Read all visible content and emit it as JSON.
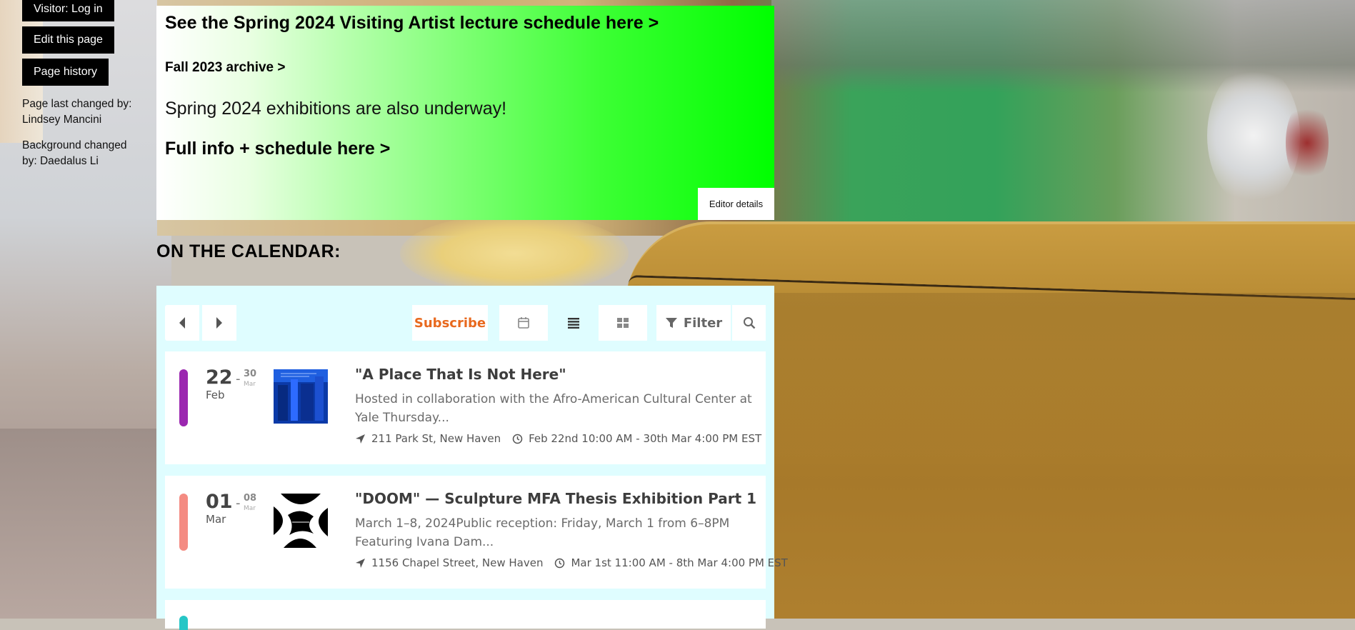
{
  "sidebar": {
    "login_label": "Visitor: Log in",
    "edit_label": "Edit this page",
    "history_label": "Page history",
    "last_changed": "Page last changed by: Lindsey Mancini",
    "background_changed": "Background changed by: Daedalus Li"
  },
  "announcement": {
    "lecture_link": "See the Spring 2024 Visiting Artist lecture schedule here >",
    "archive_link": "Fall 2023 archive >",
    "exhibitions_text": "Spring 2024 exhibitions are also underway!",
    "schedule_link": "Full info + schedule here >",
    "editor_details": "Editor details"
  },
  "calendar": {
    "heading": "ON THE CALENDAR:",
    "toolbar": {
      "prev_icon": "caret-left-icon",
      "next_icon": "caret-right-icon",
      "subscribe_label": "Subscribe",
      "calendar_view_icon": "calendar-icon",
      "list_view_icon": "list-icon",
      "grid_view_icon": "grid-icon",
      "filter_label": "Filter",
      "search_icon": "search-icon",
      "accent_color": "#e8691e"
    },
    "events": [
      {
        "start_day": "22",
        "start_month": "Feb",
        "end_day": "30",
        "end_month": "Mar",
        "color": "#9b27b0",
        "title": "\"A Place That Is Not Here\"",
        "description": "Hosted in collaboration with the Afro-American Cultural Center at Yale Thursday...",
        "location": "211 Park St, New Haven",
        "time": "Feb 22nd 10:00 AM - 30th Mar 4:00 PM EST"
      },
      {
        "start_day": "01",
        "start_month": "Mar",
        "end_day": "08",
        "end_month": "Mar",
        "color": "#f48b82",
        "title": "\"DOOM\" — Sculpture MFA Thesis Exhibition Part 1",
        "description": "March 1–8, 2024Public reception: Friday, March 1 from 6–8PM Featuring Ivana Dam...",
        "location": "1156 Chapel Street, New Haven",
        "time": "Mar 1st 11:00 AM - 8th Mar 4:00 PM EST"
      }
    ]
  }
}
